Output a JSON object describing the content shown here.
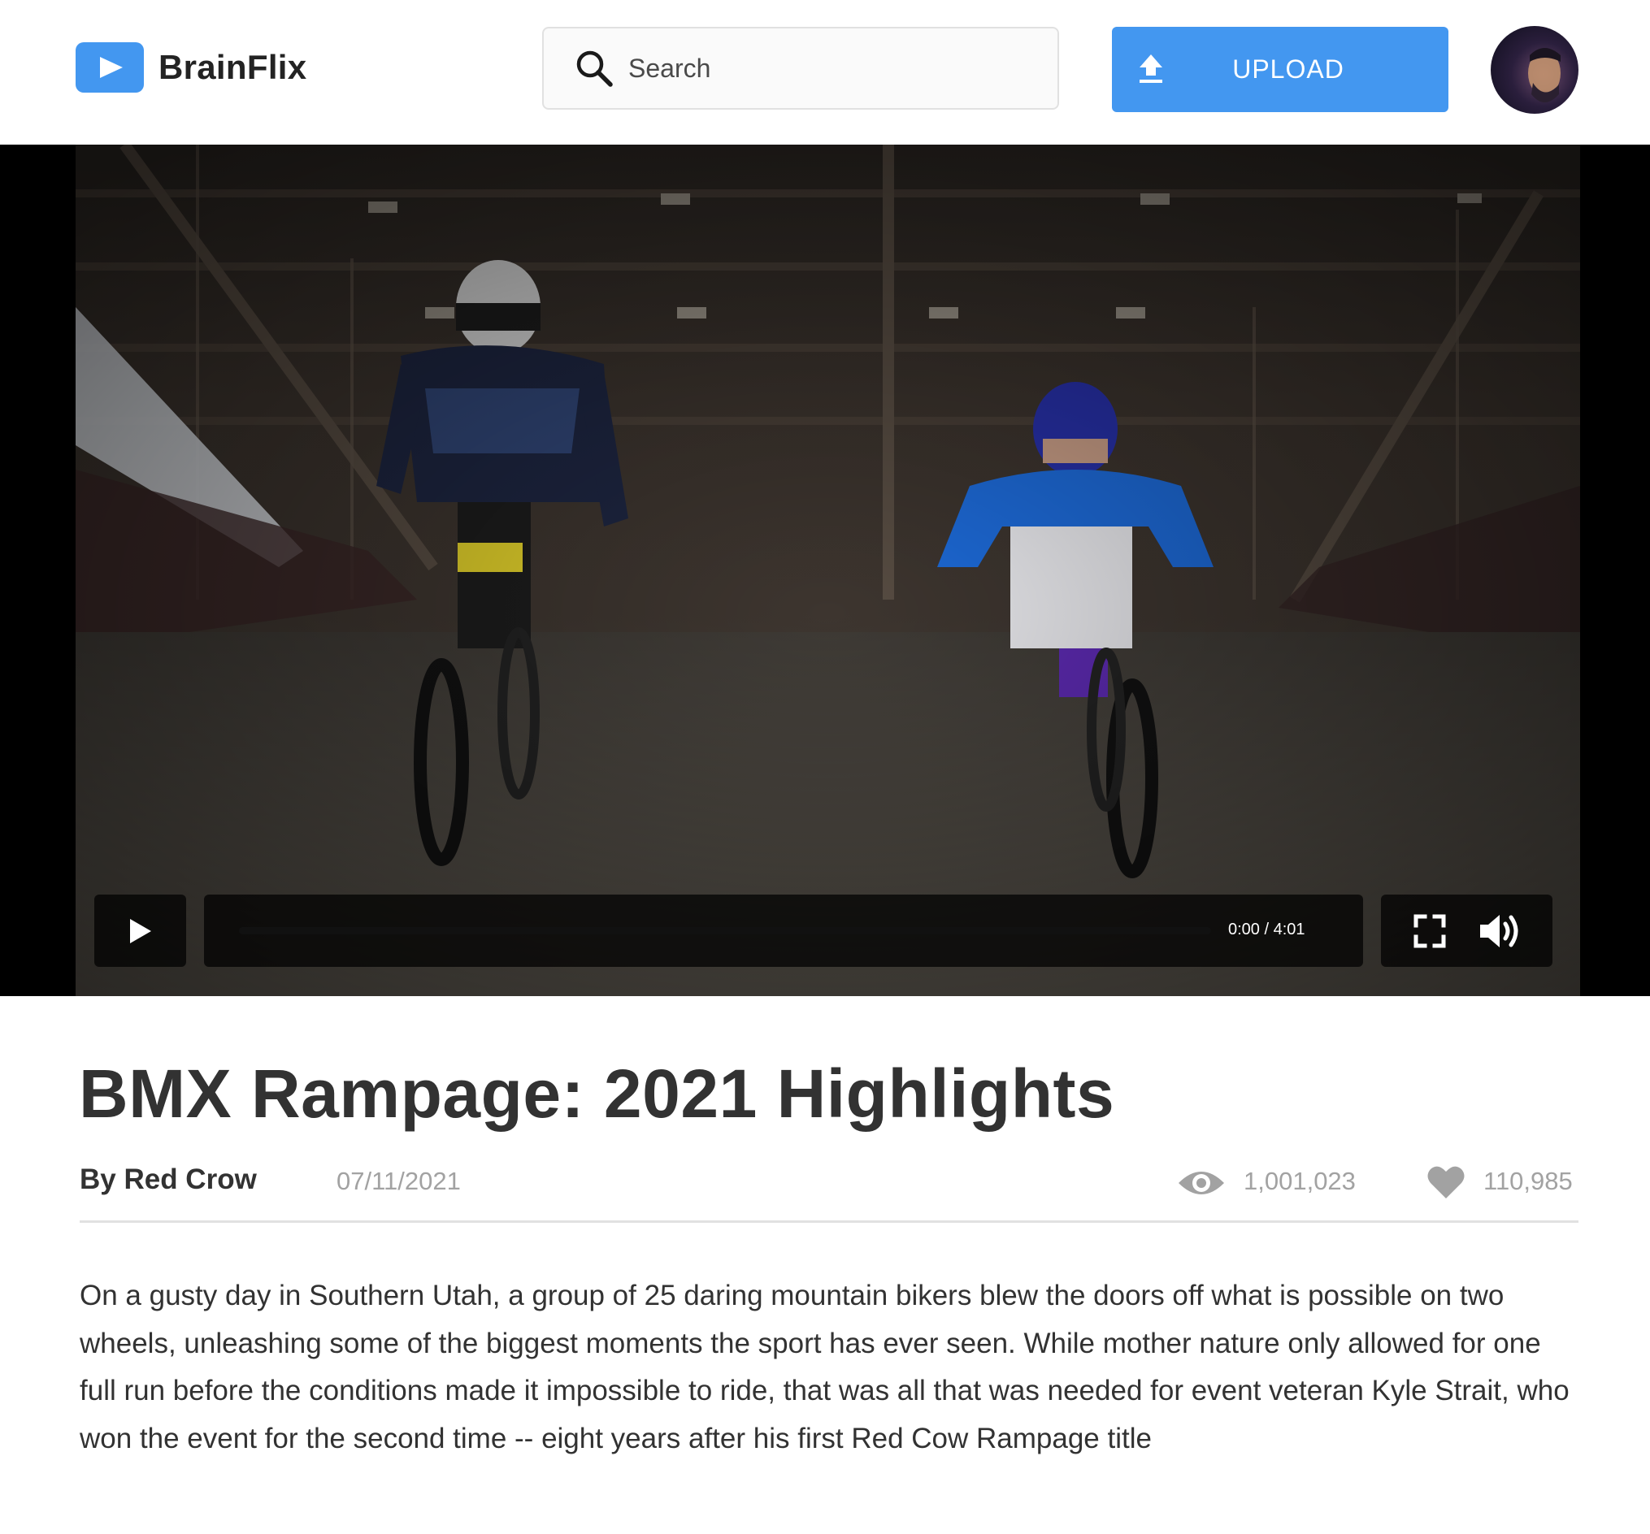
{
  "app": {
    "name": "BrainFlix"
  },
  "header": {
    "search": {
      "placeholder": "Search",
      "value": ""
    },
    "upload_label": "UPLOAD"
  },
  "player": {
    "time_current": "0:00",
    "time_total": "4:01",
    "time_display": "0:00 / 4:01",
    "progress": 0
  },
  "video": {
    "title": "BMX Rampage: 2021 Highlights",
    "byline": "By Red Crow",
    "date": "07/11/2021",
    "views": "1,001,023",
    "likes": "110,985",
    "description": "On a gusty day in Southern Utah, a group of 25 daring mountain bikers blew the doors off what is possible on two wheels, unleashing some of the biggest moments the sport has ever seen. While mother nature only allowed for one full run before the conditions made it impossible to ride, that was all that was needed for event veteran Kyle Strait, who won the event for the second time -- eight years after his first Red Cow Rampage title"
  },
  "icons": {
    "logo": "play-icon",
    "search": "search-icon",
    "upload": "upload-icon",
    "play": "play-icon",
    "fullscreen": "fullscreen-icon",
    "volume": "volume-icon",
    "views": "eye-icon",
    "likes": "heart-icon"
  },
  "colors": {
    "accent": "#4397f0",
    "text": "#323232",
    "muted": "#a2a2a2",
    "divider": "#e1e1e1"
  }
}
